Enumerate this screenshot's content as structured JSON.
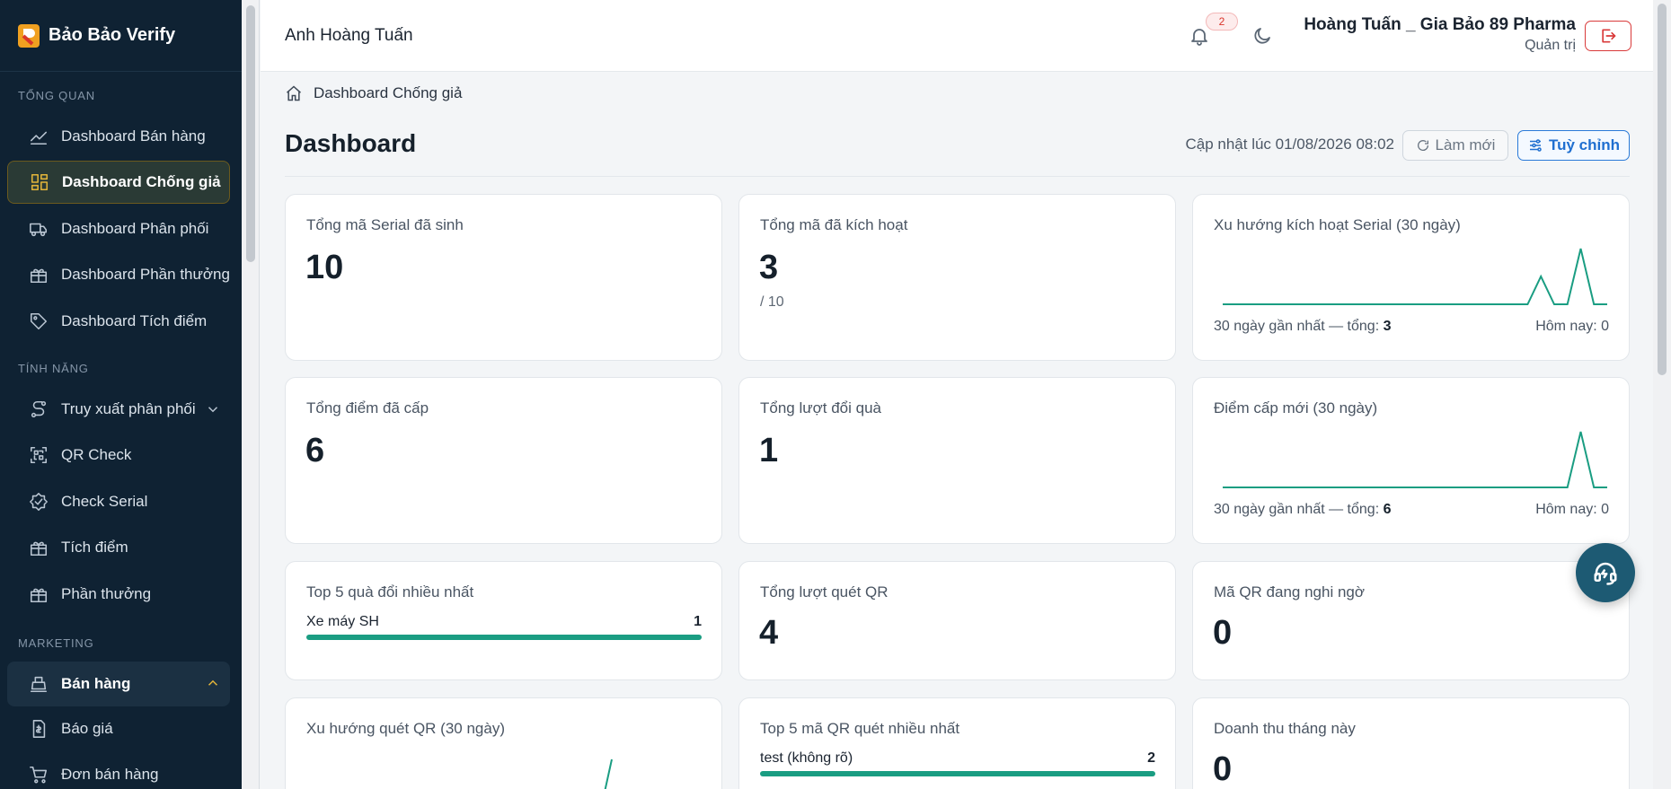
{
  "brand": {
    "name": "Bảo Bảo Verify"
  },
  "sidebar": {
    "sections": [
      {
        "title": "TỔNG QUAN"
      },
      {
        "title": "TÍNH NĂNG"
      },
      {
        "title": "MARKETING"
      }
    ],
    "items": [
      {
        "label": "Dashboard Bán hàng",
        "icon": "trend-line-icon"
      },
      {
        "label": "Dashboard Chống giả",
        "icon": "grid-dashboard-icon",
        "active": true
      },
      {
        "label": "Dashboard Phân phối",
        "icon": "truck-icon"
      },
      {
        "label": "Dashboard Phần thưởng",
        "icon": "gift-icon"
      },
      {
        "label": "Dashboard Tích điểm",
        "icon": "tag-icon"
      },
      {
        "label": "Truy xuất phân phối",
        "icon": "route-icon",
        "expandable": true
      },
      {
        "label": "QR Check",
        "icon": "qr-scan-icon"
      },
      {
        "label": "Check Serial",
        "icon": "badge-check-icon"
      },
      {
        "label": "Tích điểm",
        "icon": "gift-icon"
      },
      {
        "label": "Phần thưởng",
        "icon": "gift-icon"
      },
      {
        "label": "Bán hàng",
        "icon": "cash-register-icon",
        "expanded": true
      },
      {
        "label": "Báo giá",
        "icon": "invoice-icon"
      },
      {
        "label": "Đơn bán hàng",
        "icon": "cart-icon"
      }
    ]
  },
  "header": {
    "user_name": "Anh Hoàng Tuấn",
    "notification_count": "2",
    "company": "Hoàng Tuấn _ Gia Bảo 89 Pharma",
    "role": "Quản trị"
  },
  "breadcrumb": {
    "label": "Dashboard Chống giả"
  },
  "page": {
    "title": "Dashboard",
    "updated": "Cập nhật lúc 01/08/2026 08:02",
    "refresh_label": "Làm mới",
    "customize_label": "Tuỳ chỉnh"
  },
  "cards": {
    "serial_generated": {
      "title": "Tổng mã Serial đã sinh",
      "value": "10"
    },
    "activated": {
      "title": "Tổng mã đã kích hoạt",
      "value": "3",
      "sub": "/ 10"
    },
    "activation_trend": {
      "title": "Xu hướng kích hoạt Serial (30 ngày)",
      "foot_prefix": "30 ngày gần nhất — tổng: ",
      "total": "3",
      "today": "Hôm nay: 0",
      "values": [
        0,
        0,
        0,
        0,
        0,
        0,
        0,
        0,
        0,
        0,
        0,
        0,
        0,
        0,
        0,
        0,
        0,
        0,
        0,
        0,
        0,
        0,
        0,
        0,
        1,
        0,
        0,
        2,
        0,
        0
      ]
    },
    "points_issued": {
      "title": "Tổng điểm đã cấp",
      "value": "6"
    },
    "redemptions": {
      "title": "Tổng lượt đổi quà",
      "value": "1"
    },
    "points_trend": {
      "title": "Điểm cấp mới (30 ngày)",
      "foot_prefix": "30 ngày gần nhất — tổng: ",
      "total": "6",
      "today": "Hôm nay: 0",
      "values": [
        0,
        0,
        0,
        0,
        0,
        0,
        0,
        0,
        0,
        0,
        0,
        0,
        0,
        0,
        0,
        0,
        0,
        0,
        0,
        0,
        0,
        0,
        0,
        0,
        0,
        0,
        0,
        6,
        0,
        0
      ]
    },
    "top_gifts": {
      "title": "Top 5 quà đổi nhiều nhất",
      "rows": [
        {
          "label": "Xe máy SH",
          "value": "1"
        }
      ]
    },
    "qr_scans": {
      "title": "Tổng lượt quét QR",
      "value": "4"
    },
    "suspicious_qr": {
      "title": "Mã QR đang nghi ngờ",
      "value": "0"
    },
    "scan_trend": {
      "title": "Xu hướng quét QR (30 ngày)",
      "values": [
        0,
        0,
        0,
        0,
        0,
        0,
        0,
        0,
        0,
        0,
        0,
        0,
        0,
        0,
        0,
        0,
        0,
        0,
        0,
        0,
        0,
        0,
        0,
        0,
        0,
        0,
        0,
        0,
        0,
        0,
        0,
        4
      ]
    },
    "top_qr": {
      "title": "Top 5 mã QR quét nhiều nhất",
      "rows": [
        {
          "label": "test (không rõ)",
          "value": "2"
        }
      ]
    },
    "revenue": {
      "title": "Doanh thu tháng này",
      "value": "0"
    }
  },
  "colors": {
    "accent": "#1a9d82",
    "sidebar_bg": "#0f2233",
    "active_gold": "#e1b43a",
    "danger": "#d93a3a",
    "primary": "#1f6fd0"
  }
}
